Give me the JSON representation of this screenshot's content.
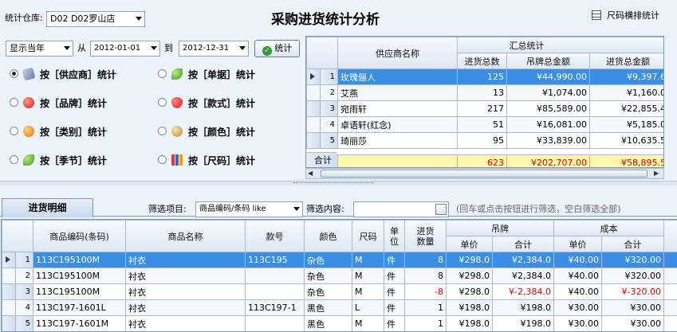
{
  "header": {
    "warehouse_label": "统计仓库:",
    "warehouse_value": "D02 D02罗山店",
    "title": "采购进货统计分析",
    "size_report_label": "尺码横排统计"
  },
  "filter": {
    "period": "显示当年",
    "from_label": "从",
    "from_date": "2012-01-01",
    "to_label": "到",
    "to_date": "2012-12-31",
    "stat_button": "统计"
  },
  "options": [
    {
      "label": "按［供应商］统计",
      "icon": "database-icon",
      "selected": true
    },
    {
      "label": "按［单据］统计",
      "icon": "green-leaf-icon",
      "selected": false
    },
    {
      "label": "按［品牌］统计",
      "icon": "red-apple-icon",
      "selected": false
    },
    {
      "label": "按［款式］统计",
      "icon": "strawberry-icon",
      "selected": false
    },
    {
      "label": "按［类别］统计",
      "icon": "orange-icon",
      "selected": false
    },
    {
      "label": "按［颜色］统计",
      "icon": "palette-icon",
      "selected": false
    },
    {
      "label": "按［季节］统计",
      "icon": "green-leaf-icon",
      "selected": false
    },
    {
      "label": "按［尺码］统计",
      "icon": "bar-chart-icon",
      "selected": false
    }
  ],
  "summary": {
    "col_supplier": "供应商名称",
    "group_label": "汇总统计",
    "col_qty": "进货总数",
    "col_tag": "吊牌总金额",
    "col_cost": "进货总金额",
    "rows": [
      {
        "no": "1",
        "name": "玫瑰俪人",
        "qty": "125",
        "tag": "¥44,990.00",
        "cost": "¥9,397.6"
      },
      {
        "no": "2",
        "name": "艾燕",
        "qty": "13",
        "tag": "¥1,074.00",
        "cost": "¥1,160.0"
      },
      {
        "no": "3",
        "name": "宛雨轩",
        "qty": "217",
        "tag": "¥85,589.00",
        "cost": "¥22,855.4"
      },
      {
        "no": "4",
        "name": "卓语轩(红念)",
        "qty": "51",
        "tag": "¥16,081.00",
        "cost": "¥5,185.0"
      },
      {
        "no": "5",
        "name": "琦丽莎",
        "qty": "95",
        "tag": "¥33,839.00",
        "cost": "¥10,635.5"
      }
    ],
    "total": {
      "label": "合计",
      "qty": "623",
      "tag": "¥202,707.00",
      "cost": "¥58,895.5"
    }
  },
  "detail": {
    "tab_label": "进货明细",
    "filter_item_label": "筛选项目:",
    "filter_item_value": "商品编码/条码 like",
    "filter_content_label": "筛选内容:",
    "filter_content_value": "",
    "hint": "(回车或点击按钮进行筛选，空白筛选全部)",
    "cols": {
      "code": "商品编码(条码)",
      "name": "商品名称",
      "style": "款号",
      "color": "颜色",
      "size": "尺码",
      "unit": "单位",
      "qty": "进货数量",
      "tag_group": "吊牌",
      "cost_group": "成本",
      "unit_price": "单价",
      "total": "合计"
    },
    "rows": [
      {
        "no": "1",
        "code": "113C195100M",
        "name": "衬衣",
        "style": "113C195",
        "color": "杂色",
        "size": "M",
        "unit": "件",
        "qty": "8",
        "tag_price": "¥298.0",
        "tag_total": "¥2,384.0",
        "cost_price": "¥40.00",
        "cost_total": "¥320.00"
      },
      {
        "no": "2",
        "code": "113C195100M",
        "name": "衬衣",
        "style": "",
        "color": "杂色",
        "size": "M",
        "unit": "件",
        "qty": "8",
        "tag_price": "¥298.0",
        "tag_total": "¥2,384.0",
        "cost_price": "¥40.00",
        "cost_total": "¥320.00"
      },
      {
        "no": "3",
        "code": "113C195100M",
        "name": "衬衣",
        "style": "",
        "color": "杂色",
        "size": "M",
        "unit": "件",
        "qty": "-8",
        "tag_price": "¥298.0",
        "tag_total": "¥-2,384.0",
        "cost_price": "¥40.00",
        "cost_total": "¥-320.00"
      },
      {
        "no": "4",
        "code": "113C197-1601L",
        "name": "衬衣",
        "style": "113C197-1",
        "color": "黑色",
        "size": "L",
        "unit": "件",
        "qty": "1",
        "tag_price": "¥198.0",
        "tag_total": "¥198.0",
        "cost_price": "¥30.00",
        "cost_total": "¥30.00"
      },
      {
        "no": "5",
        "code": "113C197-1601M",
        "name": "衬衣",
        "style": "",
        "color": "黑色",
        "size": "M",
        "unit": "件",
        "qty": "1",
        "tag_price": "¥198.0",
        "tag_total": "¥198.0",
        "cost_price": "¥30.00",
        "cost_total": "¥30.00"
      }
    ]
  },
  "colors": {
    "selection": "#3a8ee6",
    "total_bg": "#fff7a8",
    "negative": "#e00000"
  }
}
